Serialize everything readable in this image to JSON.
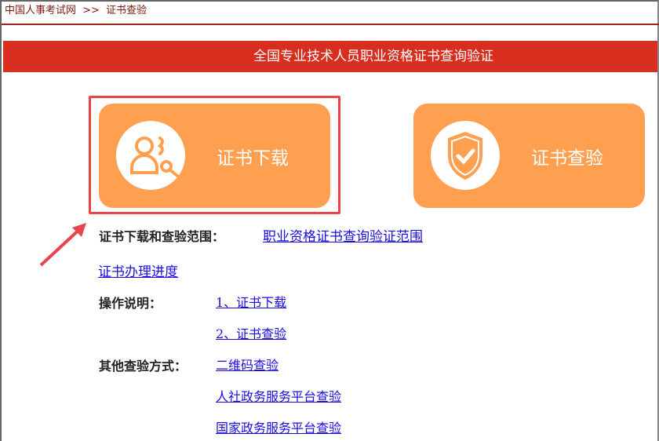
{
  "breadcrumb": {
    "home": "中国人事考试网",
    "sep": ">>",
    "current": "证书查验"
  },
  "banner": {
    "title": "全国专业技术人员职业资格证书查询验证"
  },
  "cards": [
    {
      "label": "证书下载",
      "icon": "user-search-icon"
    },
    {
      "label": "证书查验",
      "icon": "shield-check-icon"
    }
  ],
  "colors": {
    "accent": "#d72e20",
    "card": "#ff9f4f",
    "highlight": "#e8454a",
    "link": "#1a0ddd"
  },
  "scope": {
    "label": "证书下载和查验范围：",
    "link": "职业资格证书查询验证范围"
  },
  "progress_link": "证书办理进度",
  "instructions": {
    "label": "操作说明：",
    "links": [
      "1、证书下载",
      "2、证书查验"
    ]
  },
  "other": {
    "label": "其他查验方式：",
    "links": [
      "二维码查验",
      "人社政务服务平台查验",
      "国家政务服务平台查验"
    ]
  }
}
